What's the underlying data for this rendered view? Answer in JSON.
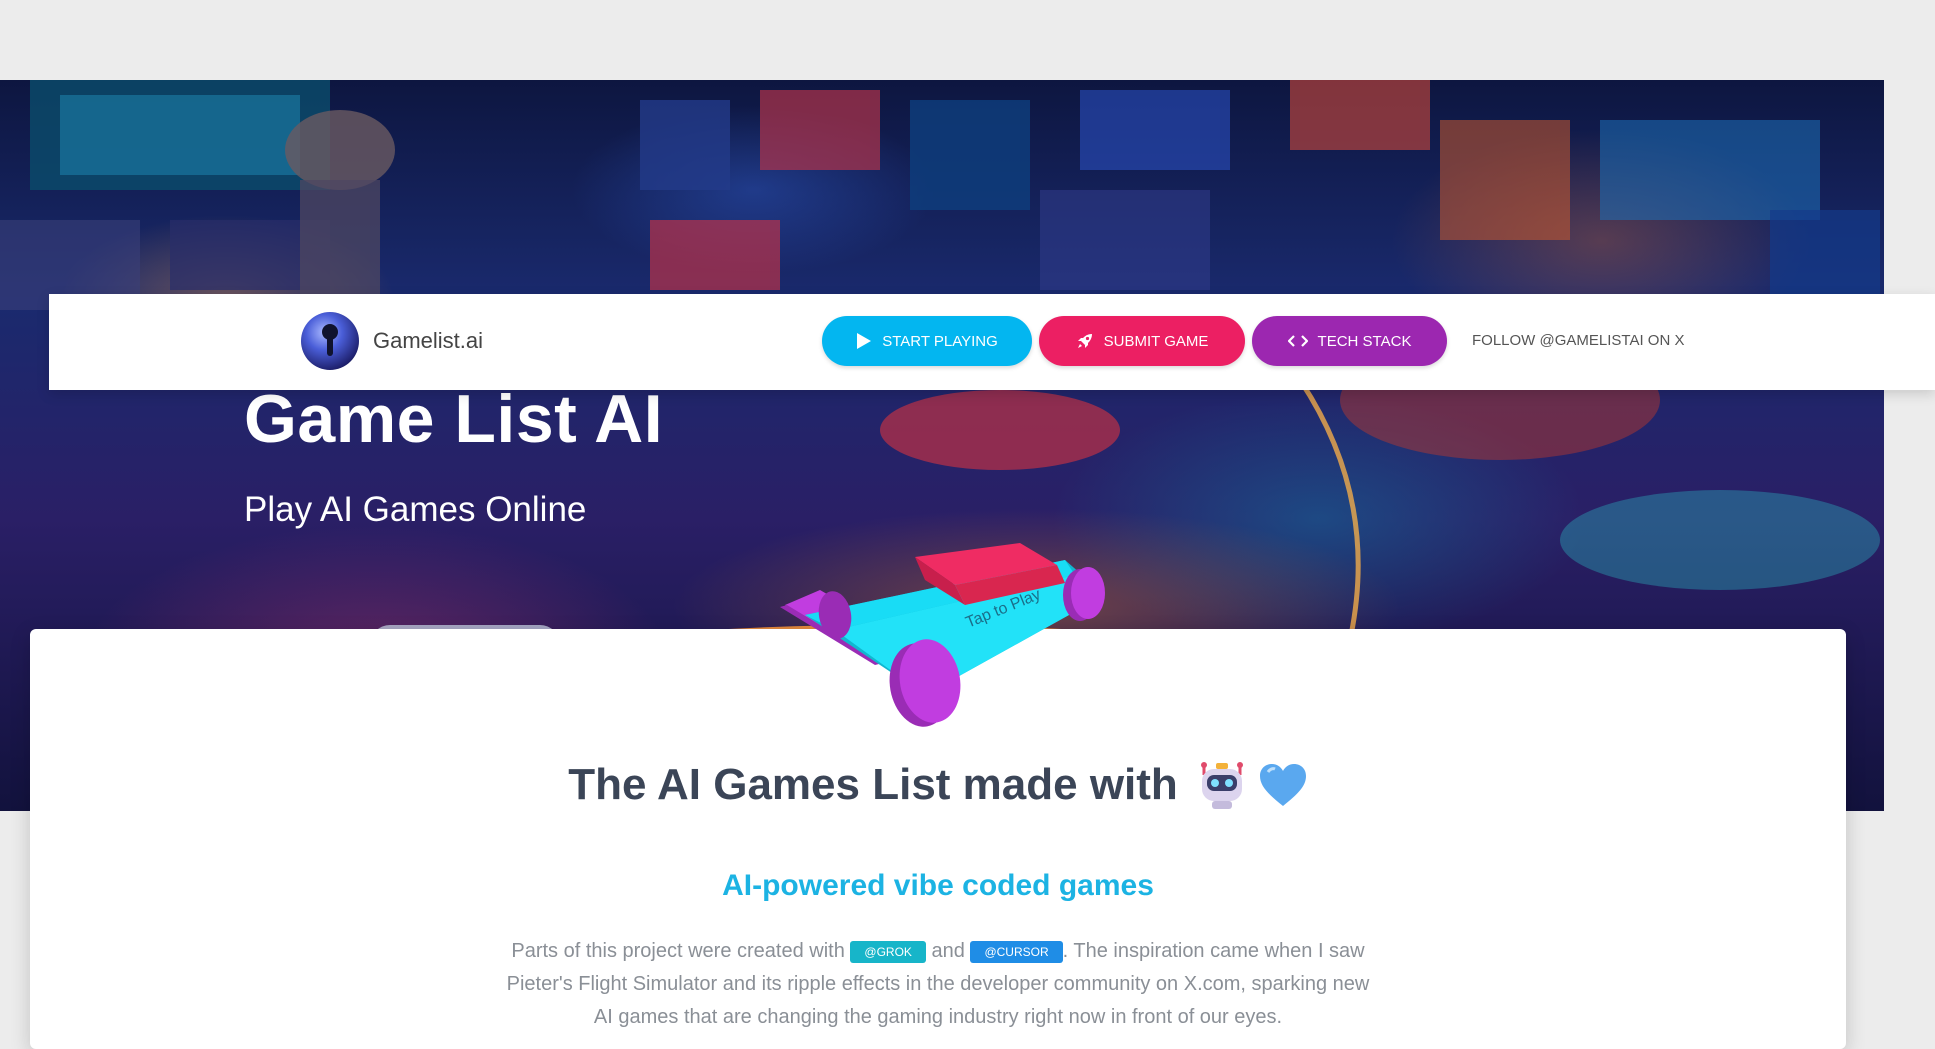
{
  "hero": {
    "title": "Game List AI",
    "subtitle": "Play AI Games Online"
  },
  "navbar": {
    "brand_name": "Gamelist.ai",
    "buttons": [
      {
        "label": "START PLAYING",
        "icon": "play-icon",
        "color": "#03b6f0"
      },
      {
        "label": "SUBMIT GAME",
        "icon": "rocket-icon",
        "color": "#ec1f63"
      },
      {
        "label": "TECH STACK",
        "icon": "code-icon",
        "color": "#9c27b0"
      }
    ],
    "follow_label": "FOLLOW @GAMELISTAI ON X"
  },
  "car": {
    "label": "Tap to Play",
    "colors": {
      "body": "#19dcf5",
      "roof": "#ef2c63",
      "wheels": "#c13de0"
    }
  },
  "content": {
    "title": "The AI Games List made with",
    "title_icons": [
      "robot-icon",
      "heart-icon"
    ],
    "subtitle": "AI-powered vibe coded games",
    "paragraph": {
      "part1": "Parts of this project were created with",
      "tag1": "@GROK",
      "part2": "and",
      "tag2": "@CURSOR",
      "part3": ". The inspiration came when I saw Pieter's Flight Simulator and its ripple effects in the developer community on X.com, sparking new AI games that are changing the gaming industry right now in front of our eyes."
    }
  }
}
